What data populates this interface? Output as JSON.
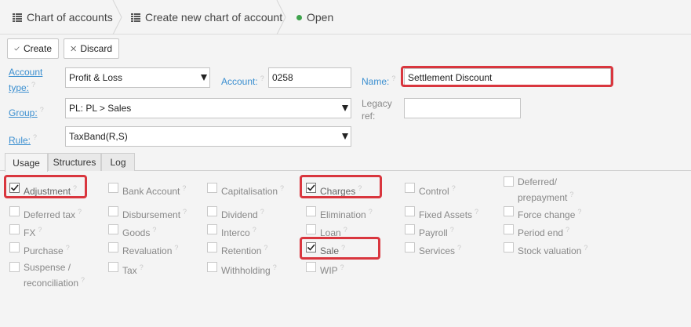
{
  "breadcrumb": {
    "items": [
      "Chart of accounts",
      "Create new chart of account",
      "Open"
    ],
    "status_color": "#3fa34d"
  },
  "toolbar": {
    "create_label": "Create",
    "discard_label": "Discard"
  },
  "form": {
    "account_type": {
      "label": "Account type:",
      "value": "Profit & Loss"
    },
    "account": {
      "label": "Account:",
      "value": "0258"
    },
    "name": {
      "label": "Name:",
      "value": "Settlement Discount"
    },
    "group": {
      "label": "Group:",
      "value": "PL: PL > Sales"
    },
    "legacy_ref": {
      "label": "Legacy ref:",
      "value": ""
    },
    "rule": {
      "label": "Rule:",
      "value": "TaxBand(R,S)"
    },
    "help_glyph": "?"
  },
  "tabs": [
    "Usage",
    "Structures",
    "Log"
  ],
  "usage": {
    "rows": [
      [
        {
          "label": "Adjustment",
          "checked": true
        },
        {
          "label": "Bank Account",
          "checked": false
        },
        {
          "label": "Capitalisation",
          "checked": false
        },
        {
          "label": "Charges",
          "checked": true
        },
        {
          "label": "Control",
          "checked": false
        },
        {
          "label": "Deferred/ prepayment",
          "checked": false
        }
      ],
      [
        {
          "label": "Deferred tax",
          "checked": false
        },
        {
          "label": "Disbursement",
          "checked": false
        },
        {
          "label": "Dividend",
          "checked": false
        },
        {
          "label": "Elimination",
          "checked": false
        },
        {
          "label": "Fixed Assets",
          "checked": false
        },
        {
          "label": "Force change",
          "checked": false
        }
      ],
      [
        {
          "label": "FX",
          "checked": false
        },
        {
          "label": "Goods",
          "checked": false
        },
        {
          "label": "Interco",
          "checked": false
        },
        {
          "label": "Loan",
          "checked": false
        },
        {
          "label": "Payroll",
          "checked": false
        },
        {
          "label": "Period end",
          "checked": false
        }
      ],
      [
        {
          "label": "Purchase",
          "checked": false
        },
        {
          "label": "Revaluation",
          "checked": false
        },
        {
          "label": "Retention",
          "checked": false
        },
        {
          "label": "Sale",
          "checked": true
        },
        {
          "label": "Services",
          "checked": false
        },
        {
          "label": "Stock valuation",
          "checked": false
        }
      ],
      [
        {
          "label": "Suspense / reconciliation",
          "checked": false
        },
        {
          "label": "Tax",
          "checked": false
        },
        {
          "label": "Withholding",
          "checked": false
        },
        {
          "label": "WIP",
          "checked": false
        }
      ]
    ]
  },
  "colors": {
    "accent": "#3b8fd0",
    "highlight": "#d9363e"
  }
}
